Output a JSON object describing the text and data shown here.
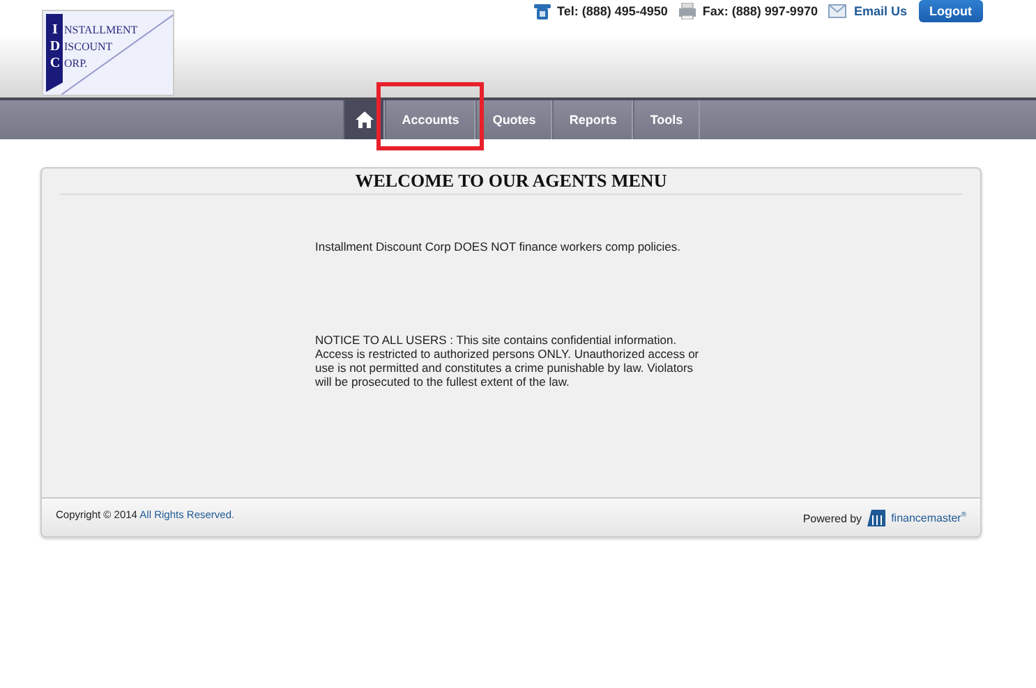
{
  "logo": {
    "lines": [
      {
        "initial": "I",
        "rest": "NSTALLMENT"
      },
      {
        "initial": "D",
        "rest": "ISCOUNT"
      },
      {
        "initial": "C",
        "rest": "ORP."
      }
    ]
  },
  "contact": {
    "tel": "Tel: (888) 495-4950",
    "fax": "Fax: (888) 997-9970",
    "email": "Email Us",
    "logout": "Logout"
  },
  "nav": [
    {
      "kind": "home",
      "selected": true,
      "highlighted": false
    },
    {
      "kind": "text",
      "label": "Accounts",
      "selected": false,
      "highlighted": true
    },
    {
      "kind": "text",
      "label": "Quotes",
      "selected": false,
      "highlighted": false
    },
    {
      "kind": "text",
      "label": "Reports",
      "selected": false,
      "highlighted": false
    },
    {
      "kind": "text",
      "label": "Tools",
      "selected": false,
      "highlighted": false
    }
  ],
  "panel": {
    "title": "WELCOME TO OUR AGENTS MENU",
    "notice": "Installment Discount Corp DOES NOT finance workers comp policies.",
    "warning": "NOTICE TO ALL USERS : This site contains confidential information. Access is restricted to authorized persons ONLY. Unauthorized access or use is not permitted and constitutes a crime punishable by law. Violators will be prosecuted to the fullest extent of the law."
  },
  "footer": {
    "copyright": "Copyright © 2014",
    "rights": "All Rights Reserved.",
    "powered": "Powered by",
    "brand": "financemaster",
    "brand_mark": "®"
  }
}
